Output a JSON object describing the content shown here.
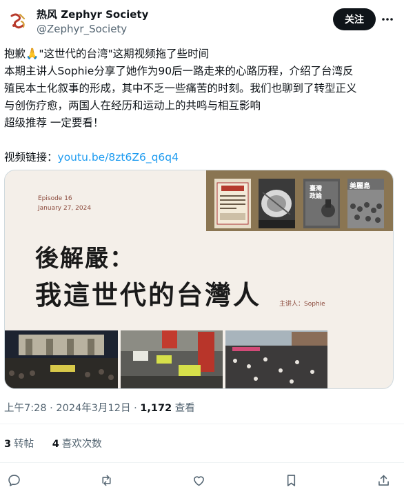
{
  "author": {
    "display_name": "热风 Zephyr Society",
    "handle": "@Zephyr_Society",
    "follow_label": "关注"
  },
  "post": {
    "line1_prefix": "抱歉",
    "line1_emoji": "🙏",
    "line1_suffix": "\"这世代的台湾\"这期视频拖了些时间",
    "line2": "本期主讲人Sophie分享了她作为90后一路走来的心路历程，介绍了台湾反",
    "line3": "殖民本土化叙事的形成，其中不乏一些痛苦的时刻。我们也聊到了转型正义",
    "line4": "与创伤疗愈，两国人在经历和运动上的共鸣与相互影响",
    "line5": "超级推荐 一定要看！",
    "link_label": "视频链接：",
    "link_text": "youtu.be/8zt6Z6_q6q4"
  },
  "media": {
    "episode": "Episode 16",
    "date": "January 27, 2024",
    "title_line1": "後解嚴：",
    "title_line2": "我這世代的台灣人",
    "speaker": "主讲人：Sophie",
    "thumb2_text": "臺灣政論",
    "thumb4_text": "美麗島"
  },
  "meta": {
    "time": "上午7:28 · 2024年3月12日 · ",
    "views_count": "1,172",
    "views_label": " 查看"
  },
  "stats": {
    "reposts_count": "3",
    "reposts_label": "转帖",
    "likes_count": "4",
    "likes_label": "喜欢次数"
  },
  "colors": {
    "accent_link": "#1d9bf0",
    "text_primary": "#0f1419",
    "text_secondary": "#536471",
    "follow_bg": "#0f1419"
  },
  "icons": [
    "avatar-logo-icon",
    "more-icon",
    "reply-icon",
    "repost-icon",
    "like-icon",
    "bookmark-icon",
    "share-icon"
  ]
}
